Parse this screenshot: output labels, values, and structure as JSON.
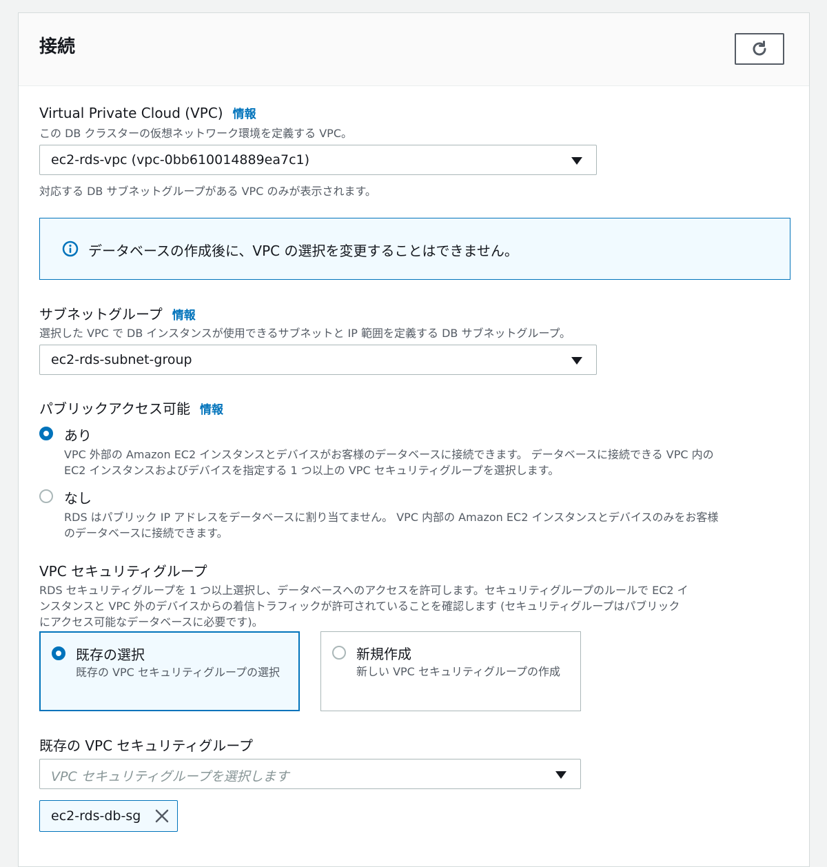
{
  "panel": {
    "title": "接続",
    "refresh_icon": "refresh-icon"
  },
  "vpc": {
    "label": "Virtual Private Cloud (VPC)",
    "info": "情報",
    "description": "この DB クラスターの仮想ネットワーク環境を定義する VPC。",
    "selected": "ec2-rds-vpc (vpc-0bb610014889ea7c1)",
    "hint": "対応する DB サブネットグループがある VPC のみが表示されます。",
    "alert": "データベースの作成後に、VPC の選択を変更することはできません。",
    "alert_icon": "info-circle-icon"
  },
  "subnet": {
    "label": "サブネットグループ",
    "info": "情報",
    "description": "選択した VPC で DB インスタンスが使用できるサブネットと IP 範囲を定義する DB サブネットグループ。",
    "selected": "ec2-rds-subnet-group"
  },
  "public_access": {
    "label": "パブリックアクセス可能",
    "info": "情報",
    "options": [
      {
        "label": "あり",
        "checked": true,
        "desc_line1": "VPC 外部の Amazon EC2 インスタンスとデバイスがお客様のデータベースに接続できます。 データベースに接続できる VPC 内の",
        "desc_line2": "EC2 インスタンスおよびデバイスを指定する 1 つ以上の VPC セキュリティグループを選択します。"
      },
      {
        "label": "なし",
        "checked": false,
        "desc_line1": "RDS はパブリック IP アドレスをデータベースに割り当てません。 VPC 内部の Amazon EC2 インスタンスとデバイスのみをお客様",
        "desc_line2": "のデータベースに接続できます。"
      }
    ]
  },
  "security_group": {
    "label": "VPC セキュリティグループ",
    "desc_line1": "RDS セキュリティグループを 1 つ以上選択し、データベースへのアクセスを許可します。セキュリティグループのルールで EC2 イ",
    "desc_line2": "ンスタンスと VPC 外のデバイスからの着信トラフィックが許可されていることを確認します (セキュリティグループはパブリック",
    "desc_line3": "にアクセス可能なデータベースに必要です)。",
    "tiles": [
      {
        "label": "既存の選択",
        "desc": "既存の VPC セキュリティグループの選択",
        "selected": true
      },
      {
        "label": "新規作成",
        "desc": "新しい VPC セキュリティグループの作成",
        "selected": false
      }
    ]
  },
  "existing_sg": {
    "label": "既存の VPC セキュリティグループ",
    "placeholder": "VPC セキュリティグループを選択します",
    "token": "ec2-rds-db-sg"
  },
  "colors": {
    "accent": "#0073bb",
    "alert_bg": "#f1faff",
    "text": "#16191f",
    "muted": "#545b64"
  }
}
